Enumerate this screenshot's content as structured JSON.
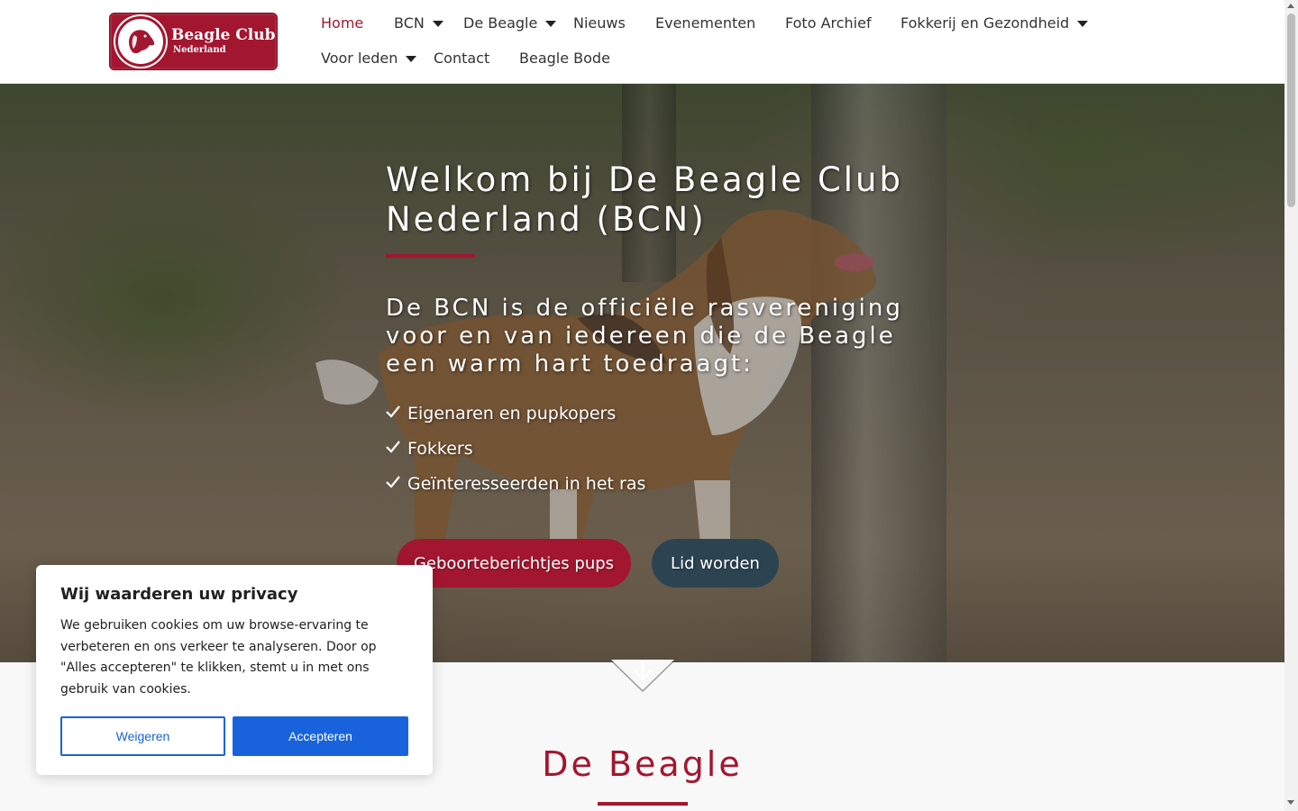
{
  "header": {
    "logo": {
      "title": "Beagle Club",
      "subtitle": "Nederland"
    },
    "nav": [
      {
        "label": "Home",
        "active": true,
        "dropdown": false
      },
      {
        "label": "BCN",
        "active": false,
        "dropdown": true
      },
      {
        "label": "De Beagle",
        "active": false,
        "dropdown": true
      },
      {
        "label": "Nieuws",
        "active": false,
        "dropdown": false
      },
      {
        "label": "Evenementen",
        "active": false,
        "dropdown": false
      },
      {
        "label": "Foto Archief",
        "active": false,
        "dropdown": false
      },
      {
        "label": "Fokkerij en Gezondheid",
        "active": false,
        "dropdown": true
      },
      {
        "label": "Voor leden",
        "active": false,
        "dropdown": true
      },
      {
        "label": "Contact",
        "active": false,
        "dropdown": false
      },
      {
        "label": "Beagle Bode",
        "active": false,
        "dropdown": false
      }
    ]
  },
  "hero": {
    "title": "Welkom bij De Beagle Club Nederland (BCN)",
    "subtitle": "De BCN is de officiële rasvereniging voor en van iedereen die de Beagle een warm hart toedraagt:",
    "list": [
      "Eigenaren en pupkopers",
      "Fokkers",
      "Geïnteresseerden in het ras"
    ],
    "buttons": {
      "pups": "Geboorteberichtjes pups",
      "member": "Lid worden"
    }
  },
  "section": {
    "title": "De Beagle"
  },
  "cookie": {
    "title": "Wij waarderen uw privacy",
    "text": "We gebruiken cookies om uw browse-ervaring te verbeteren en ons verkeer te analyseren. Door op \"Alles accepteren\" te klikken, stemt u in met ons gebruik van cookies.",
    "reject": "Weigeren",
    "accept": "Accepteren"
  },
  "colors": {
    "brand": "#a3162f",
    "secondary": "#2c4452",
    "cookie_accent": "#1863dc"
  },
  "icons": [
    "beagle-logo-icon",
    "chevron-down-icon",
    "check-icon",
    "arrow-down-icon"
  ]
}
